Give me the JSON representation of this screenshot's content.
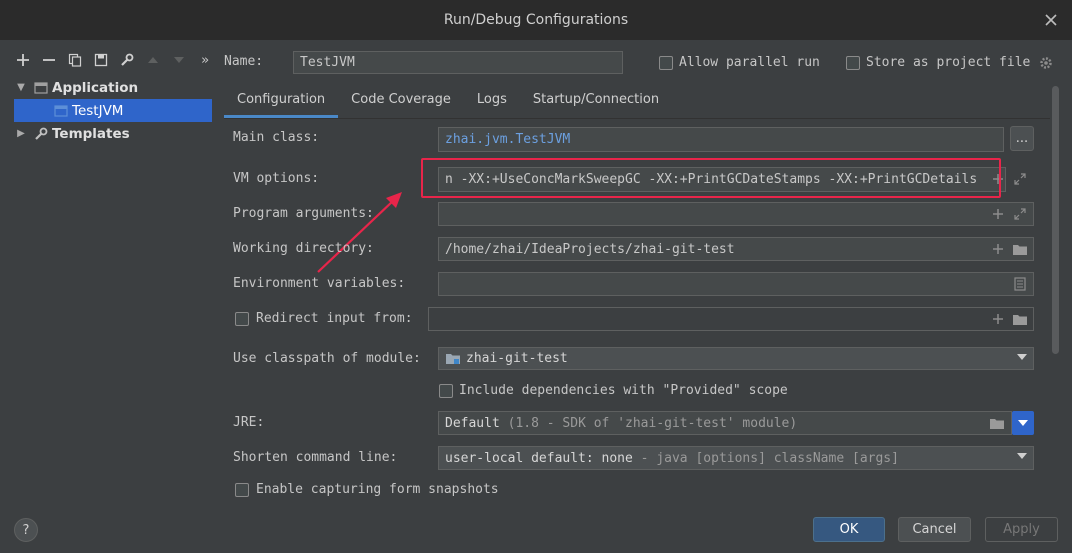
{
  "window": {
    "title": "Run/Debug Configurations"
  },
  "toolbar": {
    "icons": [
      "add-icon",
      "remove-icon",
      "copy-icon",
      "save-icon",
      "wrench-icon",
      "move-up-icon",
      "move-down-icon",
      "more-icon"
    ],
    "more_glyph": "»"
  },
  "tree": {
    "application": "Application",
    "testjvm": "TestJVM",
    "templates": "Templates"
  },
  "name_field": {
    "label": "Name:",
    "value": "TestJVM"
  },
  "options": {
    "allow_parallel": "Allow parallel run",
    "store_project": "Store as project file"
  },
  "tabs": [
    "Configuration",
    "Code Coverage",
    "Logs",
    "Startup/Connection"
  ],
  "form": {
    "main_class_label": "Main class:",
    "main_class_value": "zhai.jvm.TestJVM",
    "browse_label": "...",
    "vm_options_label": "VM options:",
    "vm_options_value": "n -XX:+UseConcMarkSweepGC -XX:+PrintGCDateStamps -XX:+PrintGCDetails",
    "program_args_label": "Program arguments:",
    "working_dir_label": "Working directory:",
    "working_dir_value": "/home/zhai/IdeaProjects/zhai-git-test",
    "env_vars_label": "Environment variables:",
    "redirect_label": "Redirect input from:",
    "classpath_label": "Use classpath of module:",
    "classpath_value": "zhai-git-test",
    "include_deps_label": "Include dependencies with \"Provided\" scope",
    "jre_label": "JRE:",
    "jre_value": "Default",
    "jre_detail": "(1.8 - SDK of 'zhai-git-test' module)",
    "shorten_label": "Shorten command line:",
    "shorten_value": "user-local default: none",
    "shorten_detail": "- java [options] className [args]",
    "snapshots_label": "Enable capturing form snapshots"
  },
  "buttons": {
    "ok": "OK",
    "cancel": "Cancel",
    "apply": "Apply",
    "help": "?"
  },
  "colors": {
    "accent": "#2f65ca",
    "annotation": "#e8254a",
    "primary_button": "#365880"
  }
}
